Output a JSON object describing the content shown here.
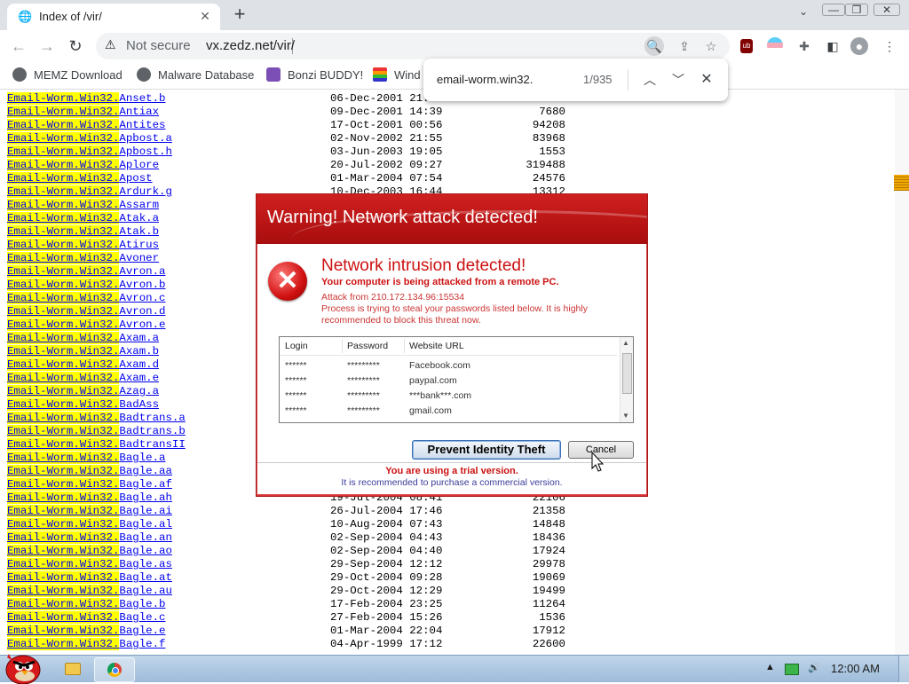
{
  "browser": {
    "tab_title": "Index of /vir/",
    "new_tab_symbol": "+",
    "security_label": "Not secure",
    "url": "vx.zedz.net/vir/"
  },
  "bookmarks": [
    "MEMZ Download",
    "Malware Database",
    "Bonzi BUDDY!",
    "Wind"
  ],
  "find_bar": {
    "query": "email-worm.win32.",
    "match_count": "1/935"
  },
  "listing": {
    "prefix": "Email-Worm.Win32.",
    "rows": [
      {
        "suffix": "Anset.b",
        "date": "06-Dec-2001 21:45",
        "size": ""
      },
      {
        "suffix": "Antiax",
        "date": "09-Dec-2001 14:39",
        "size": "7680"
      },
      {
        "suffix": "Antites",
        "date": "17-Oct-2001 00:56",
        "size": "94208"
      },
      {
        "suffix": "Apbost.a",
        "date": "02-Nov-2002 21:55",
        "size": "83968"
      },
      {
        "suffix": "Apbost.h",
        "date": "03-Jun-2003 19:05",
        "size": "1553"
      },
      {
        "suffix": "Aplore",
        "date": "20-Jul-2002 09:27",
        "size": "319488"
      },
      {
        "suffix": "Apost",
        "date": "01-Mar-2004 07:54",
        "size": "24576"
      },
      {
        "suffix": "Ardurk.g",
        "date": "10-Dec-2003 16:44",
        "size": "13312"
      },
      {
        "suffix": "Assarm",
        "date": "",
        "size": ""
      },
      {
        "suffix": "Atak.a",
        "date": "",
        "size": ""
      },
      {
        "suffix": "Atak.b",
        "date": "",
        "size": ""
      },
      {
        "suffix": "Atirus",
        "date": "",
        "size": ""
      },
      {
        "suffix": "Avoner",
        "date": "",
        "size": ""
      },
      {
        "suffix": "Avron.a",
        "date": "",
        "size": ""
      },
      {
        "suffix": "Avron.b",
        "date": "",
        "size": ""
      },
      {
        "suffix": "Avron.c",
        "date": "",
        "size": ""
      },
      {
        "suffix": "Avron.d",
        "date": "",
        "size": ""
      },
      {
        "suffix": "Avron.e",
        "date": "",
        "size": ""
      },
      {
        "suffix": "Axam.a",
        "date": "",
        "size": ""
      },
      {
        "suffix": "Axam.b",
        "date": "",
        "size": ""
      },
      {
        "suffix": "Axam.d",
        "date": "",
        "size": ""
      },
      {
        "suffix": "Axam.e",
        "date": "",
        "size": ""
      },
      {
        "suffix": "Azag.a",
        "date": "",
        "size": ""
      },
      {
        "suffix": "BadAss",
        "date": "",
        "size": ""
      },
      {
        "suffix": "Badtrans.a",
        "date": "",
        "size": ""
      },
      {
        "suffix": "Badtrans.b",
        "date": "",
        "size": ""
      },
      {
        "suffix": "BadtransII",
        "date": "",
        "size": ""
      },
      {
        "suffix": "Bagle.a",
        "date": "",
        "size": ""
      },
      {
        "suffix": "Bagle.aa",
        "date": "",
        "size": ""
      },
      {
        "suffix": "Bagle.af",
        "date": "",
        "size": ""
      },
      {
        "suffix": "Bagle.ah",
        "date": "19-Jul-2004 08:41",
        "size": "22106"
      },
      {
        "suffix": "Bagle.ai",
        "date": "26-Jul-2004 17:46",
        "size": "21358"
      },
      {
        "suffix": "Bagle.al",
        "date": "10-Aug-2004 07:43",
        "size": "14848"
      },
      {
        "suffix": "Bagle.an",
        "date": "02-Sep-2004 04:43",
        "size": "18436"
      },
      {
        "suffix": "Bagle.ao",
        "date": "02-Sep-2004 04:40",
        "size": "17924"
      },
      {
        "suffix": "Bagle.as",
        "date": "29-Sep-2004 12:12",
        "size": "29978"
      },
      {
        "suffix": "Bagle.at",
        "date": "29-Oct-2004 09:28",
        "size": "19069"
      },
      {
        "suffix": "Bagle.au",
        "date": "29-Oct-2004 12:29",
        "size": "19499"
      },
      {
        "suffix": "Bagle.b",
        "date": "17-Feb-2004 23:25",
        "size": "11264"
      },
      {
        "suffix": "Bagle.c",
        "date": "27-Feb-2004 15:26",
        "size": "1536"
      },
      {
        "suffix": "Bagle.e",
        "date": "01-Mar-2004 22:04",
        "size": "17912"
      },
      {
        "suffix": "Bagle.f",
        "date": "04-Apr-1999 17:12",
        "size": "22600"
      }
    ]
  },
  "dialog": {
    "title": "Warning! Network attack detected!",
    "headline": "Network intrusion detected!",
    "subline": "Your computer is being attacked from a remote PC.",
    "attack_from": "Attack from 210.172.134.96:15534",
    "description": "Process is trying to steal your passwords listed below. It is highly recommended to block this threat now.",
    "columns": [
      "Login",
      "Password",
      "Website URL"
    ],
    "entries": [
      {
        "login": "******",
        "password": "*********",
        "url": "Facebook.com"
      },
      {
        "login": "******",
        "password": "*********",
        "url": "paypal.com"
      },
      {
        "login": "******",
        "password": "*********",
        "url": "***bank***.com"
      },
      {
        "login": "******",
        "password": "*********",
        "url": "gmail.com"
      }
    ],
    "primary_button": "Prevent Identity Theft",
    "cancel_button": "Cancel",
    "trial_notice": "You are using a trial version.",
    "recommend_notice": "It is recommended to purchase a commercial version."
  },
  "taskbar": {
    "clock": "12:00 AM"
  },
  "colors": {
    "highlight": "#ffff00",
    "link": "#0000ee",
    "dialog_red": "#cc1111",
    "titlebar_red": "#b81414"
  }
}
